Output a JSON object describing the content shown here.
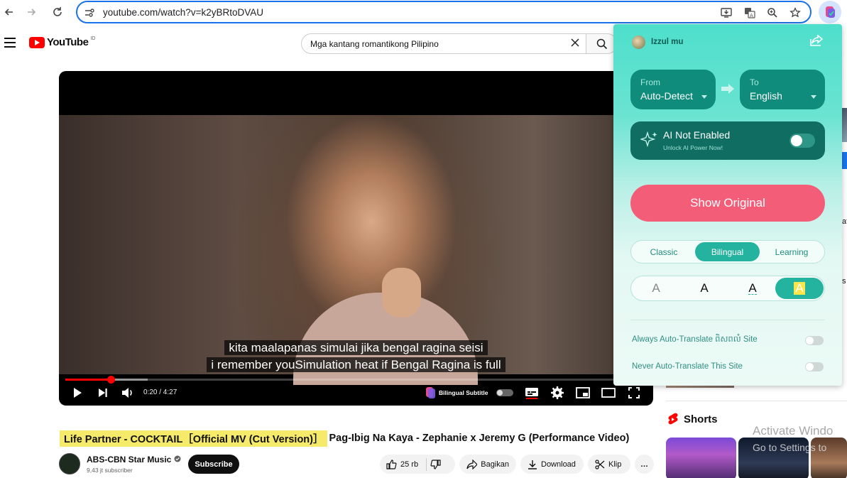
{
  "browser": {
    "url": "youtube.com/watch?v=k2yBRtoDVAU"
  },
  "youtube": {
    "logo_text": "YouTube",
    "region_code": "ID",
    "search_query": "Mga kantang romantikong Pilipino"
  },
  "player": {
    "subtitle_original": "kita maalapanas simulai jika bengal ragina seisi",
    "subtitle_translated": "i remember youSimulation heat if Bengal Ragina is full",
    "time": "0:20 / 4:27",
    "played_fraction": 0.078,
    "loaded_fraction": 0.142,
    "bilingual_label": "Bilingual Subtitle"
  },
  "video": {
    "title_highlight": "Life Partner - COCKTAIL［Official MV (Cut Version)］",
    "title_rest": "Pag-Ibig Na Kaya - Zephanie x Jeremy G (Performance Video)",
    "channel_name": "ABS-CBN Star Music",
    "subscribers": "9,43 jt subscriber",
    "subscribe_label": "Subscribe",
    "likes": "25 rb",
    "share_label": "Bagikan",
    "download_label": "Download",
    "clip_label": "Klip",
    "more_label": "…"
  },
  "sidebar": {
    "shorts_label": "Shorts",
    "frag_1": "af",
    "frag_2": "s"
  },
  "watermark": {
    "line1": "Activate Windo",
    "line2": "Go to Settings to"
  },
  "translator": {
    "user_name": "Izzul mu",
    "from_label": "From",
    "from_value": "Auto-Detect",
    "to_label": "To",
    "to_value": "English",
    "ai_title": "AI Not Enabled",
    "ai_subtitle": "Unlock AI Power Now!",
    "show_original": "Show Original",
    "modes": [
      "Classic",
      "Bilingual",
      "Learning"
    ],
    "active_mode": "Bilingual",
    "style_glyph": "A",
    "always_auto_label": "Always Auto-Translate ពិសពលំ Site",
    "never_auto_label": "Never Auto-Translate This Site",
    "accent_color": "#24b39f",
    "button_color": "#f45d78"
  }
}
